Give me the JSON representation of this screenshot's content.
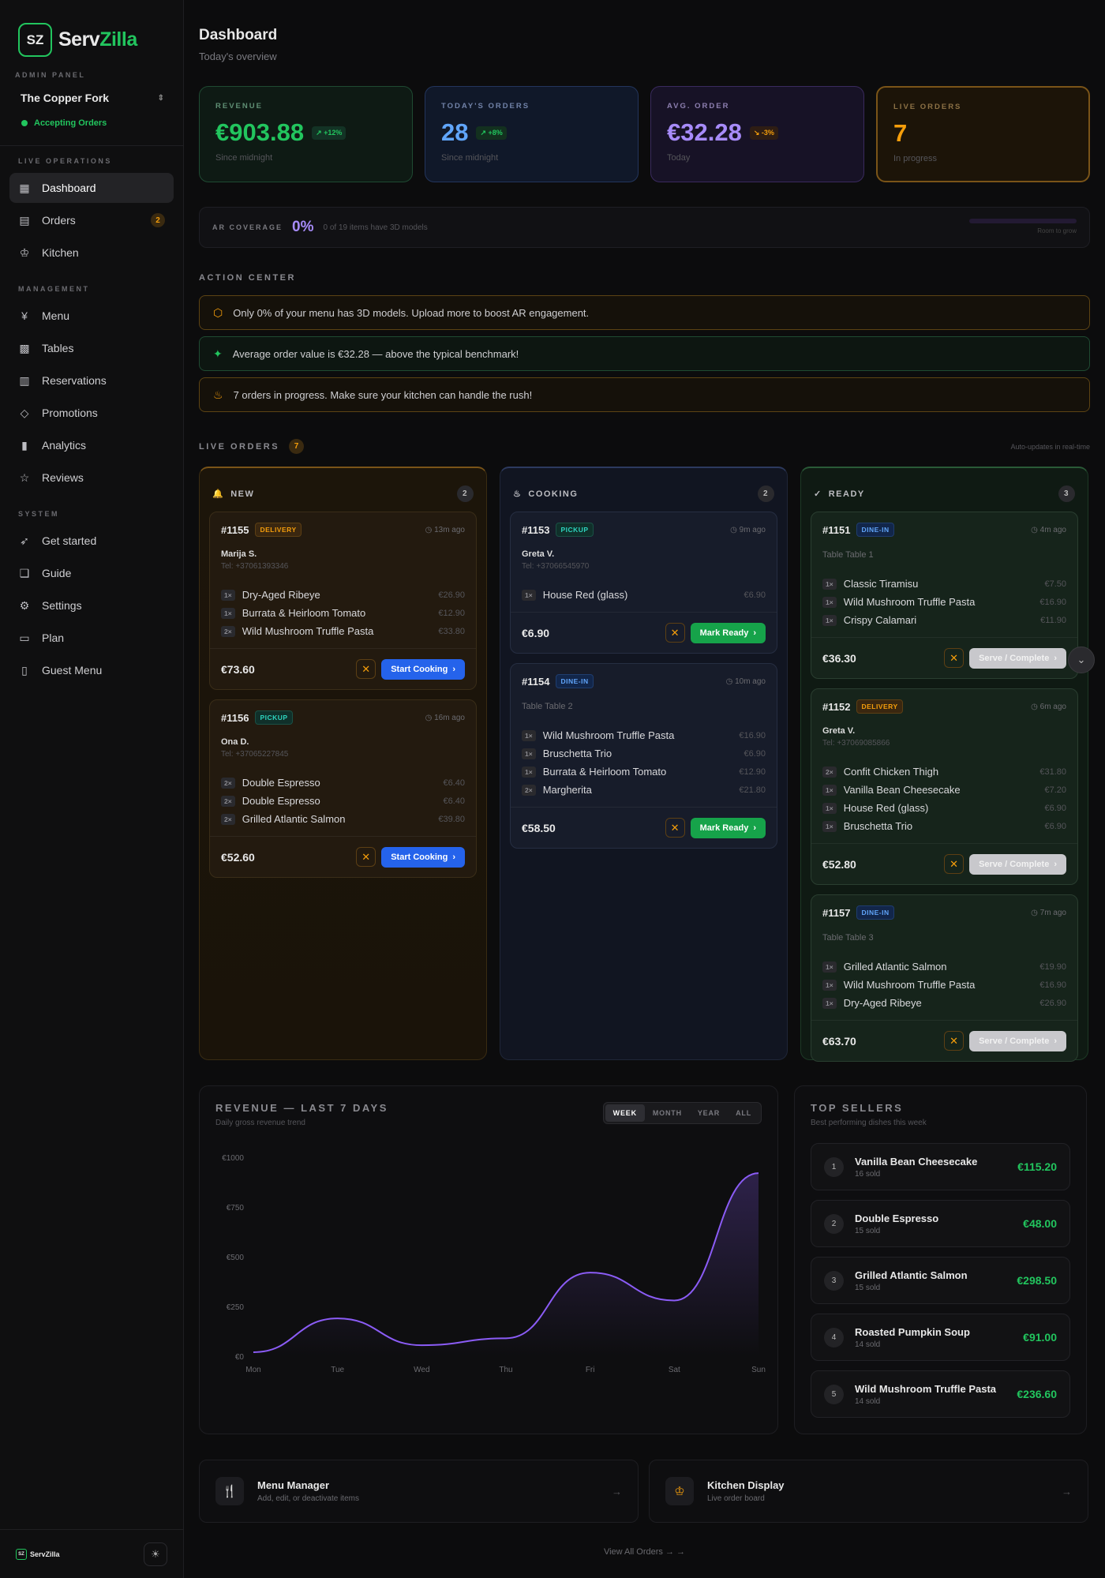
{
  "brand": {
    "badge": "SZ",
    "name_a": "Serv",
    "name_b": "Zilla"
  },
  "sidebar": {
    "admin_label": "ADMIN PANEL",
    "restaurant": "The Copper Fork",
    "status": "Accepting Orders",
    "groups": [
      {
        "label": "LIVE OPERATIONS",
        "items": [
          {
            "label": "Dashboard",
            "icon": "grid-icon",
            "active": true
          },
          {
            "label": "Orders",
            "icon": "receipt-icon",
            "badge": "2"
          },
          {
            "label": "Kitchen",
            "icon": "chef-hat-icon"
          }
        ]
      },
      {
        "label": "MANAGEMENT",
        "items": [
          {
            "label": "Menu",
            "icon": "utensils-icon"
          },
          {
            "label": "Tables",
            "icon": "qr-icon"
          },
          {
            "label": "Reservations",
            "icon": "book-icon"
          },
          {
            "label": "Promotions",
            "icon": "tag-icon"
          },
          {
            "label": "Analytics",
            "icon": "bar-chart-icon"
          },
          {
            "label": "Reviews",
            "icon": "star-icon"
          }
        ]
      },
      {
        "label": "SYSTEM",
        "items": [
          {
            "label": "Get started",
            "icon": "rocket-icon"
          },
          {
            "label": "Guide",
            "icon": "book-open-icon"
          },
          {
            "label": "Settings",
            "icon": "gear-icon"
          },
          {
            "label": "Plan",
            "icon": "credit-card-icon"
          },
          {
            "label": "Guest Menu",
            "icon": "phone-icon"
          }
        ]
      }
    ],
    "footer_brand": "ServZilla"
  },
  "header": {
    "title": "Dashboard",
    "subtitle": "Today's overview"
  },
  "stats": [
    {
      "label": "REVENUE",
      "value": "€903.88",
      "change": "+12%",
      "sub": "Since midnight"
    },
    {
      "label": "TODAY'S ORDERS",
      "value": "28",
      "change": "+8%",
      "sub": "Since midnight"
    },
    {
      "label": "AVG. ORDER",
      "value": "€32.28",
      "change": "-3%",
      "sub": "Today"
    },
    {
      "label": "LIVE ORDERS",
      "value": "7",
      "change": "",
      "sub": "In progress"
    }
  ],
  "ar": {
    "label": "AR COVERAGE",
    "pct": "0%",
    "text": "0 of 19 items have 3D models",
    "progress": 0,
    "room": "Room to grow"
  },
  "action_center": {
    "label": "ACTION CENTER",
    "alerts": [
      {
        "text": "Only 0% of your menu has 3D models. Upload more to boost AR engagement.",
        "icon": "cube-icon"
      },
      {
        "text": "Average order value is €32.28 — above the typical benchmark!",
        "icon": "party-icon"
      },
      {
        "text": "7 orders in progress. Make sure your kitchen can handle the rush!",
        "icon": "flame-icon"
      }
    ]
  },
  "live": {
    "label": "LIVE ORDERS",
    "count": "7",
    "auto": "Auto-updates in real-time",
    "columns": [
      {
        "label": "NEW",
        "count": "2",
        "orders": [
          {
            "id": "#1155",
            "type": "DELIVERY",
            "ago": "13m ago",
            "customer": "Marija S.",
            "tel": "Tel: +37061393346",
            "items": [
              {
                "q": "1×",
                "n": "Dry-Aged Ribeye",
                "p": "€26.90"
              },
              {
                "q": "1×",
                "n": "Burrata & Heirloom Tomato",
                "p": "€12.90"
              },
              {
                "q": "2×",
                "n": "Wild Mushroom Truffle Pasta",
                "p": "€33.80"
              }
            ],
            "total": "€73.60",
            "action": "Start Cooking"
          },
          {
            "id": "#1156",
            "type": "PICKUP",
            "ago": "16m ago",
            "customer": "Ona D.",
            "tel": "Tel: +37065227845",
            "items": [
              {
                "q": "2×",
                "n": "Double Espresso",
                "p": "€6.40"
              },
              {
                "q": "2×",
                "n": "Double Espresso",
                "p": "€6.40"
              },
              {
                "q": "2×",
                "n": "Grilled Atlantic Salmon",
                "p": "€39.80"
              }
            ],
            "total": "€52.60",
            "action": "Start Cooking"
          }
        ]
      },
      {
        "label": "COOKING",
        "count": "2",
        "orders": [
          {
            "id": "#1153",
            "type": "PICKUP",
            "ago": "9m ago",
            "customer": "Greta V.",
            "tel": "Tel: +37066545970",
            "items": [
              {
                "q": "1×",
                "n": "House Red (glass)",
                "p": "€6.90"
              }
            ],
            "total": "€6.90",
            "action": "Mark Ready"
          },
          {
            "id": "#1154",
            "type": "DINE-IN",
            "ago": "10m ago",
            "table": "Table Table 2",
            "items": [
              {
                "q": "1×",
                "n": "Wild Mushroom Truffle Pasta",
                "p": "€16.90"
              },
              {
                "q": "1×",
                "n": "Bruschetta Trio",
                "p": "€6.90"
              },
              {
                "q": "1×",
                "n": "Burrata & Heirloom Tomato",
                "p": "€12.90"
              },
              {
                "q": "2×",
                "n": "Margherita",
                "p": "€21.80"
              }
            ],
            "total": "€58.50",
            "action": "Mark Ready"
          }
        ]
      },
      {
        "label": "READY",
        "count": "3",
        "orders": [
          {
            "id": "#1151",
            "type": "DINE-IN",
            "ago": "4m ago",
            "table": "Table Table 1",
            "items": [
              {
                "q": "1×",
                "n": "Classic Tiramisu",
                "p": "€7.50"
              },
              {
                "q": "1×",
                "n": "Wild Mushroom Truffle Pasta",
                "p": "€16.90"
              },
              {
                "q": "1×",
                "n": "Crispy Calamari",
                "p": "€11.90"
              }
            ],
            "total": "€36.30",
            "action": "Serve / Complete"
          },
          {
            "id": "#1152",
            "type": "DELIVERY",
            "ago": "6m ago",
            "customer": "Greta V.",
            "tel": "Tel: +37069085866",
            "items": [
              {
                "q": "2×",
                "n": "Confit Chicken Thigh",
                "p": "€31.80"
              },
              {
                "q": "1×",
                "n": "Vanilla Bean Cheesecake",
                "p": "€7.20"
              },
              {
                "q": "1×",
                "n": "House Red (glass)",
                "p": "€6.90"
              },
              {
                "q": "1×",
                "n": "Bruschetta Trio",
                "p": "€6.90"
              }
            ],
            "total": "€52.80",
            "action": "Serve / Complete"
          },
          {
            "id": "#1157",
            "type": "DINE-IN",
            "ago": "7m ago",
            "table": "Table Table 3",
            "items": [
              {
                "q": "1×",
                "n": "Grilled Atlantic Salmon",
                "p": "€19.90"
              },
              {
                "q": "1×",
                "n": "Wild Mushroom Truffle Pasta",
                "p": "€16.90"
              },
              {
                "q": "1×",
                "n": "Dry-Aged Ribeye",
                "p": "€26.90"
              }
            ],
            "total": "€63.70",
            "action": "Serve / Complete"
          }
        ]
      }
    ]
  },
  "revenue": {
    "title": "REVENUE — LAST 7 DAYS",
    "subtitle": "Daily gross revenue trend",
    "tabs": [
      "WEEK",
      "MONTH",
      "YEAR",
      "ALL"
    ],
    "active_tab": "WEEK"
  },
  "chart_data": {
    "type": "area",
    "title": "REVENUE — LAST 7 DAYS",
    "x": [
      "Mon",
      "Tue",
      "Wed",
      "Thu",
      "Fri",
      "Sat",
      "Sun"
    ],
    "y_ticks": [
      "€0",
      "€250",
      "€500",
      "€750",
      "€1000"
    ],
    "ylim": [
      0,
      1000
    ],
    "series": [
      {
        "values": [
          20,
          190,
          55,
          90,
          420,
          280,
          920
        ]
      }
    ],
    "color": "#8b5cf6",
    "grid": false
  },
  "top_sellers": {
    "title": "TOP SELLERS",
    "subtitle": "Best performing dishes this week",
    "items": [
      {
        "rank": "1",
        "name": "Vanilla Bean Cheesecake",
        "sold": "16 sold",
        "amount": "€115.20"
      },
      {
        "rank": "2",
        "name": "Double Espresso",
        "sold": "15 sold",
        "amount": "€48.00"
      },
      {
        "rank": "3",
        "name": "Grilled Atlantic Salmon",
        "sold": "15 sold",
        "amount": "€298.50"
      },
      {
        "rank": "4",
        "name": "Roasted Pumpkin Soup",
        "sold": "14 sold",
        "amount": "€91.00"
      },
      {
        "rank": "5",
        "name": "Wild Mushroom Truffle Pasta",
        "sold": "14 sold",
        "amount": "€236.60"
      }
    ]
  },
  "shortcuts": [
    {
      "title": "Menu Manager",
      "sub": "Add, edit, or deactivate items",
      "icon": "utensils-icon"
    },
    {
      "title": "Kitchen Display",
      "sub": "Live order board",
      "icon": "chef-hat-icon"
    }
  ],
  "view_all": "View All Orders → →"
}
